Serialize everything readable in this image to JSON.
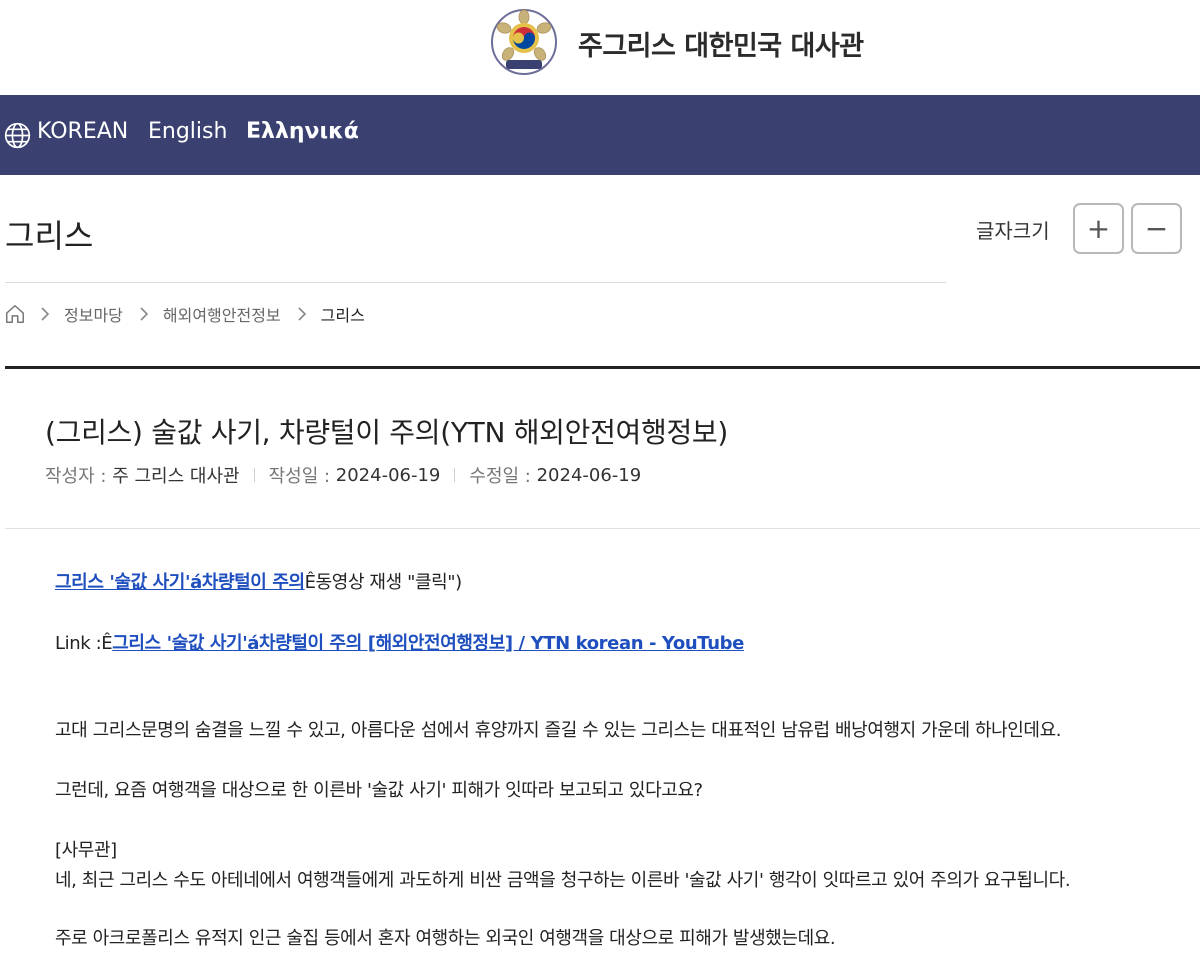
{
  "header": {
    "site_title": "주그리스 대한민국 대사관"
  },
  "languages": {
    "korean": "KOREAN",
    "english": "English",
    "greek": "Ελληνικά"
  },
  "page": {
    "title": "그리스",
    "font_size_label": "글자크기",
    "font_plus": "+",
    "font_minus": "−"
  },
  "breadcrumb": {
    "items": [
      "정보마당",
      "해외여행안전정보",
      "그리스"
    ]
  },
  "article": {
    "title": "(그리스) 술값 사기, 차량털이 주의(YTN 해외안전여행정보)",
    "author_label": "작성자 :",
    "author": "주 그리스 대사관",
    "created_label": "작성일 :",
    "created": "2024-06-19",
    "modified_label": "수정일 :",
    "modified": "2024-06-19"
  },
  "content": {
    "video_link": "그리스 '술값 사기'á차량털이 주의",
    "video_suffix": "Ê동영상 재생 \"클릭\")",
    "link_prefix": "Link :Ê",
    "youtube_link": "그리스 '술값 사기'á차량털이 주의 [해외안전여행정보] / YTN korean - YouTube",
    "para1": "고대 그리스문명의 숨결을 느낄 수 있고, 아름다운 섬에서 휴양까지 즐길 수 있는 그리스는 대표적인 남유럽 배낭여행지 가운데 하나인데요.",
    "para2": "그런데, 요즘 여행객을 대상으로 한 이른바 '술값 사기' 피해가 잇따라 보고되고 있다고요?",
    "para3_label": "[사무관]",
    "para3": "네, 최근 그리스 수도 아테네에서 여행객들에게 과도하게 비싼 금액을 청구하는 이른바 '술값 사기' 행각이 잇따르고 있어 주의가 요구됩니다.",
    "para4": "주로 아크로폴리스 유적지 인근 술집 등에서 혼자 여행하는 외국인 여행객을 대상으로 피해가 발생했는데요."
  },
  "colors": {
    "nav_bg": "#3a4170",
    "link": "#1f4fbf"
  },
  "icons": {
    "emblem": "emblem-icon",
    "globe": "globe-icon",
    "home": "home-icon",
    "chevron": "chevron-right-icon"
  }
}
